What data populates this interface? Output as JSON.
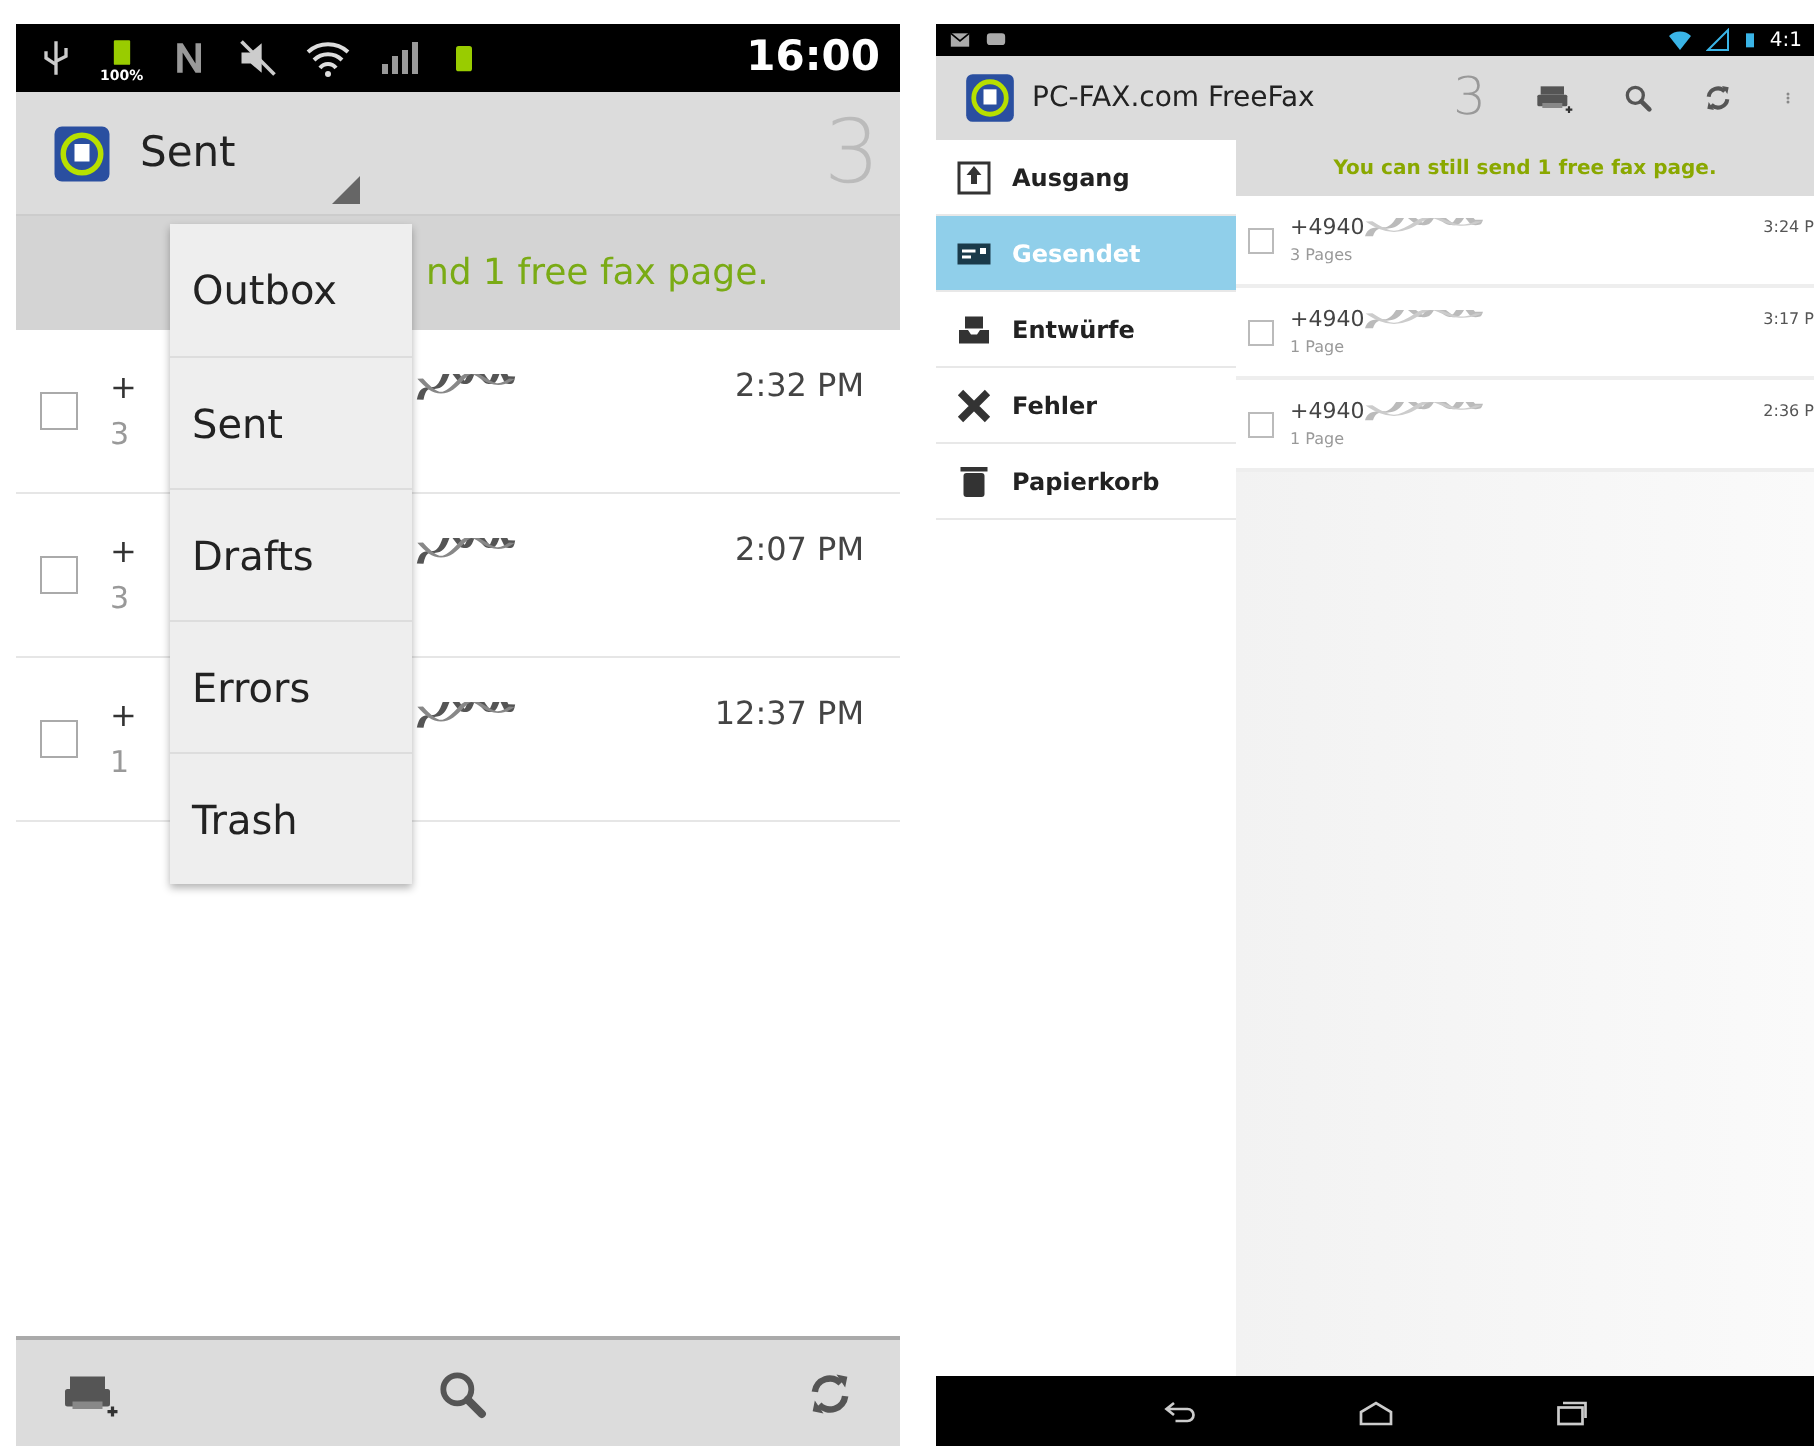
{
  "left_screen": {
    "status_bar": {
      "battery_label": "100%",
      "time": "16:00"
    },
    "action_bar": {
      "title": "Sent",
      "count": "3"
    },
    "banner": "nd 1 free fax page.",
    "rows": [
      {
        "number": "+",
        "pages": "3",
        "time": "2:32 PM",
        "checked": false
      },
      {
        "number": "+",
        "pages": "3",
        "time": "2:07 PM",
        "checked": false
      },
      {
        "number": "+",
        "pages": "1",
        "time": "12:37 PM",
        "checked": false
      }
    ],
    "dropdown": [
      {
        "label": "Outbox",
        "selected": false
      },
      {
        "label": "Sent",
        "selected": false
      },
      {
        "label": "Drafts",
        "selected": false
      },
      {
        "label": "Errors",
        "selected": false
      },
      {
        "label": "Trash",
        "selected": false
      }
    ]
  },
  "right_screen": {
    "status_bar": {
      "time": "4:1"
    },
    "action_bar": {
      "title": "PC-FAX.com FreeFax",
      "count": "3"
    },
    "sidebar": [
      {
        "label": "Ausgang",
        "selected": false
      },
      {
        "label": "Gesendet",
        "selected": true
      },
      {
        "label": "Entwürfe",
        "selected": false
      },
      {
        "label": "Fehler",
        "selected": false
      },
      {
        "label": "Papierkorb",
        "selected": false
      }
    ],
    "banner": "You can still send 1 free fax page.",
    "rows": [
      {
        "number": "+4940",
        "pages": "3 Pages",
        "time": "3:24 P",
        "checked": false
      },
      {
        "number": "+4940",
        "pages": "1 Page",
        "time": "3:17 P",
        "checked": false
      },
      {
        "number": "+4940",
        "pages": "1 Page",
        "time": "2:36 P",
        "checked": false
      }
    ]
  }
}
